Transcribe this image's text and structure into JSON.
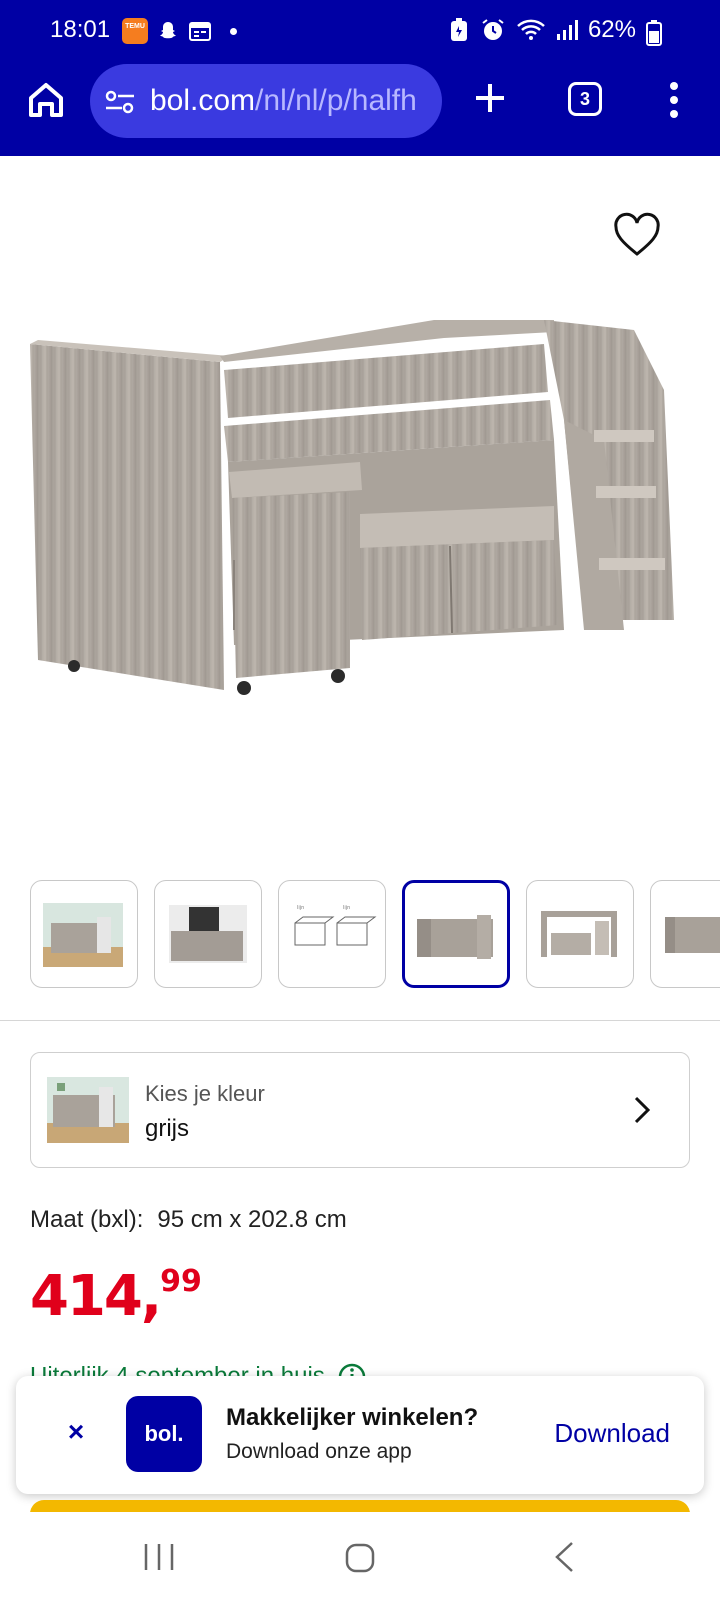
{
  "status_bar": {
    "time": "18:01",
    "battery": "62%",
    "icons": [
      "temu-icon",
      "snapchat-icon",
      "calendar-icon",
      "dot-icon",
      "battery-saver-icon",
      "alarm-icon",
      "wifi-icon",
      "signal-icon",
      "battery-icon"
    ],
    "temu_text": "TEMU"
  },
  "browser": {
    "url_domain": "bol.com",
    "url_path": "/nl/nl/p/halfh",
    "tab_count": "3",
    "colors": {
      "chrome": "#0000a4",
      "pill": "#3a3ae0"
    }
  },
  "product": {
    "image_alt": "halfhoogslaper",
    "thumbnail_count": 6,
    "active_thumbnail": 4
  },
  "color_selector": {
    "label": "Kies je kleur",
    "value": "grijs"
  },
  "size": {
    "label": "Maat (bxl):",
    "value": "95 cm x 202.8 cm"
  },
  "price": {
    "integer": "414,",
    "decimals": "99",
    "color": "#e0001b"
  },
  "delivery": {
    "text": "Uiterlijk 4 september in huis"
  },
  "app_banner": {
    "logo_text": "bol.",
    "title": "Makkelijker winkelen?",
    "subtitle": "Download onze app",
    "cta": "Download",
    "close": "×"
  }
}
